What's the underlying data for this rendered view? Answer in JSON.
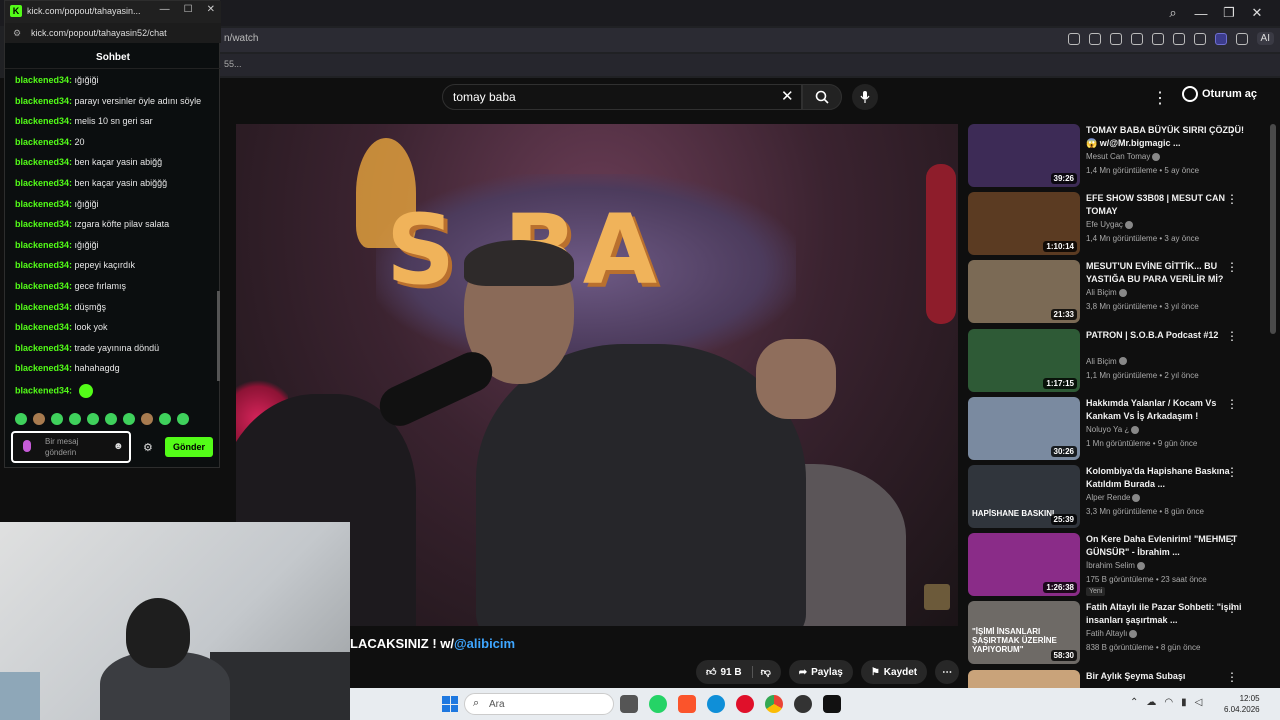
{
  "browser": {
    "url_partial": "n/watch",
    "bookmark_partial": "55...",
    "ai_label": "AI"
  },
  "youtube": {
    "search": {
      "value": "tomay baba"
    },
    "signin_label": "Oturum aç",
    "video": {
      "title_text": "LACAKSINIZ ! w/",
      "title_handle": "@alibicim",
      "likes": "91 B",
      "share_label": "Paylaş",
      "save_label": "Kaydet"
    },
    "recommendations": [
      {
        "title": "TOMAY BABA BÜYÜK SIRRI ÇÖZDÜ!😱 w/@Mr.bigmagic ...",
        "channel": "Mesut Can Tomay",
        "meta": "1,4 Mn görüntüleme • 5 ay önce",
        "duration": "39:26",
        "thumb_color": "#3d2b56"
      },
      {
        "title": "EFE SHOW S3B08 | MESUT CAN TOMAY",
        "channel": "Efe Uygaç",
        "meta": "1,4 Mn görüntüleme • 3 ay önce",
        "duration": "1:10:14",
        "thumb_color": "#5b3b22"
      },
      {
        "title": "MESUT'UN EVİNE GİTTİK... BU YASTIĞA BU PARA VERİLİR Mİ?",
        "channel": "Ali Biçim",
        "meta": "3,8 Mn görüntüleme • 3 yıl önce",
        "duration": "21:33",
        "thumb_color": "#7b6a55"
      },
      {
        "title": "PATRON | S.O.B.A Podcast #12",
        "channel": "Ali Biçim",
        "meta": "1,1 Mn görüntüleme • 2 yıl önce",
        "duration": "1:17:15",
        "thumb_color": "#2e5a36"
      },
      {
        "title": "Hakkımda Yalanlar / Kocam Vs Kankam Vs İş Arkadaşım !",
        "channel": "Noluyo Ya ¿",
        "meta": "1 Mn görüntüleme • 9 gün önce",
        "duration": "30:26",
        "thumb_color": "#7a8aa0"
      },
      {
        "title": "Kolombiya'da Hapishane Baskına Katıldım Burada ...",
        "channel": "Alper Rende",
        "meta": "3,3 Mn görüntüleme • 8 gün önce",
        "duration": "25:39",
        "thumb_color": "#30353c",
        "overlay": "HAPİSHANE BASKINI"
      },
      {
        "title": "On Kere Daha Evlenirim! \"MEHMET GÜNSÜR\" - İbrahim ...",
        "channel": "İbrahim Selim",
        "meta": "175 B görüntüleme • 23 saat önce",
        "duration": "1:26:38",
        "thumb_color": "#8a2c88",
        "badge": "Yeni"
      },
      {
        "title": "Fatih Altaylı ile Pazar Sohbeti: \"işimi insanları şaşırtmak ...",
        "channel": "Fatih Altaylı",
        "meta": "838 B görüntüleme • 8 gün önce",
        "duration": "58:30",
        "thumb_color": "#6e6a66",
        "overlay": "\"İŞİMİ İNSANLARI ŞAŞIRTMAK ÜZERİNE YAPIYORUM\""
      },
      {
        "title": "Bir Aylık Şeyma Subaşı",
        "channel": "",
        "meta": "",
        "duration": "",
        "thumb_color": "#c9a37a"
      }
    ]
  },
  "chat": {
    "window_url": "kick.com/popout/tahayasin...",
    "url": "kick.com/popout/tahayasin52/chat",
    "header": "Sohbet",
    "messages": [
      {
        "user": "blackened34",
        "text": "ığığiği"
      },
      {
        "user": "blackened34",
        "text": "parayı versinler öyle adını söyle"
      },
      {
        "user": "blackened34",
        "text": "melis 10 sn geri sar"
      },
      {
        "user": "blackened34",
        "text": "20"
      },
      {
        "user": "blackened34",
        "text": "ben kaçar yasin abiğğ"
      },
      {
        "user": "blackened34",
        "text": "ben kaçar yasin abiğğğ"
      },
      {
        "user": "blackened34",
        "text": "ığığiği"
      },
      {
        "user": "blackened34",
        "text": "ızgara köfte pilav salata"
      },
      {
        "user": "blackened34",
        "text": "ığığiği"
      },
      {
        "user": "blackened34",
        "text": "pepeyi kaçırdık"
      },
      {
        "user": "blackened34",
        "text": "gece fırlamış"
      },
      {
        "user": "blackened34",
        "text": "düşmğş"
      },
      {
        "user": "blackened34",
        "text": "look yok"
      },
      {
        "user": "blackened34",
        "text": "trade yayınına döndü"
      },
      {
        "user": "blackened34",
        "text": "hahahagdg"
      },
      {
        "user": "blackened34",
        "text": ""
      }
    ],
    "input_placeholder": "Bir mesaj gönderin",
    "send_label": "Gönder"
  },
  "taskbar": {
    "search_placeholder": "Ara",
    "time": "12:05",
    "date": "6.04.2026"
  },
  "colors": {
    "kick_green": "#53fc18",
    "youtube_link": "#3ea6ff"
  }
}
